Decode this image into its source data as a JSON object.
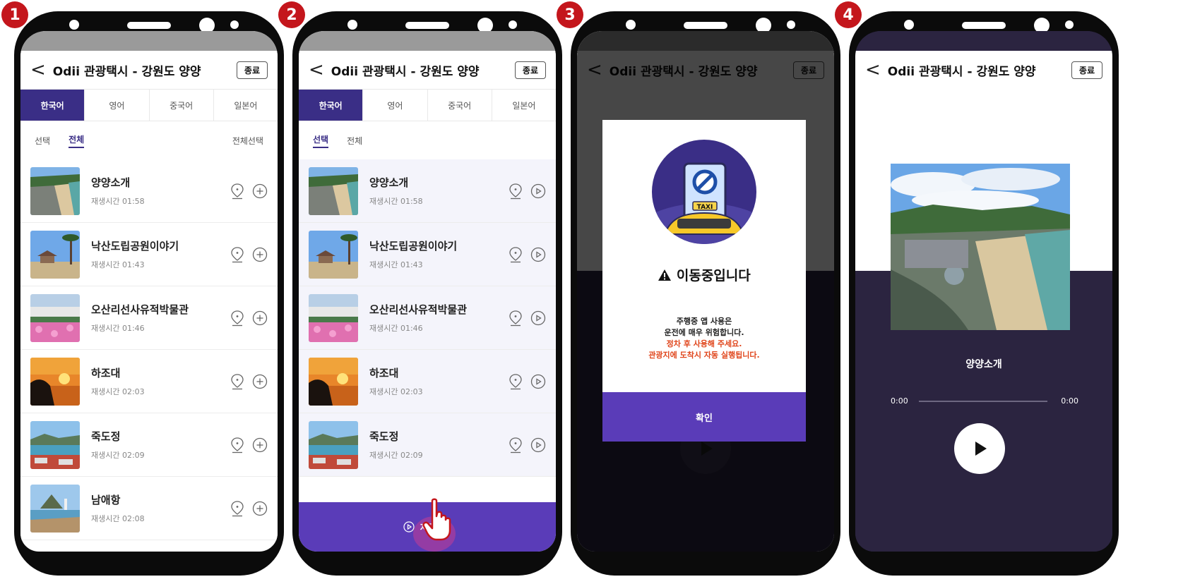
{
  "steps": [
    "1",
    "2",
    "3",
    "4"
  ],
  "app": {
    "back_glyph": "<",
    "title": "Odii 관광택시 - 강원도 양양",
    "end_label": "종료"
  },
  "languages": [
    "한국어",
    "영어",
    "중국어",
    "일본어"
  ],
  "filter": {
    "select_label": "선택",
    "all_label": "전체",
    "select_all_label": "전체선택"
  },
  "items": [
    {
      "name": "양양소개",
      "time": "재생시간 01:58",
      "thumb": "beach"
    },
    {
      "name": "낙산도립공원이야기",
      "time": "재생시간 01:43",
      "thumb": "palm"
    },
    {
      "name": "오산리선사유적박물관",
      "time": "재생시간 01:46",
      "thumb": "flowers"
    },
    {
      "name": "하조대",
      "time": "재생시간 02:03",
      "thumb": "sunset"
    },
    {
      "name": "죽도정",
      "time": "재생시간 02:09",
      "thumb": "harbor"
    },
    {
      "name": "남애항",
      "time": "재생시간 02:08",
      "thumb": "rocks"
    }
  ],
  "autoplay_label": "자동재생",
  "modal": {
    "title": "이동중입니다",
    "line1": "주행중 앱 사용은",
    "line2": "운전에 매우 위험합니다.",
    "line3_red": "정차 후 사용해 주세요.",
    "line4_red": "관광지에 도착시 자동 실행됩니다.",
    "ok_label": "확인",
    "sign_text": "TAXI"
  },
  "player": {
    "track_title": "양양소개",
    "current_time": "0:00",
    "total_time": "0:00",
    "progress_fraction": 0
  },
  "colors": {
    "primary": "#3a2e86",
    "accent": "#5a3cb8",
    "warning_red": "#e0451b",
    "badge": "#c4161c",
    "player_bg": "#2b2440"
  }
}
